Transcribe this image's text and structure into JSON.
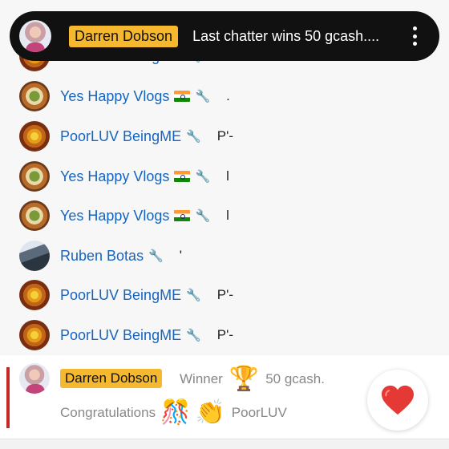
{
  "pinned": {
    "name": "Darren Dobson",
    "text": "Last chatter wins 50 gcash....",
    "menu_icon": "more-vertical-icon"
  },
  "messages": [
    {
      "name": "PoorLUV BeingME",
      "text": "",
      "avatar": "poorluv-avatar"
    },
    {
      "name": "Yes Happy Vlogs",
      "text": ".",
      "avatar": "food-avatar",
      "flag": true
    },
    {
      "name": "PoorLUV BeingME",
      "text": "P'-",
      "avatar": "poorluv-avatar"
    },
    {
      "name": "Yes Happy Vlogs",
      "text": "l",
      "avatar": "food-avatar",
      "flag": true
    },
    {
      "name": "Yes Happy Vlogs",
      "text": "l",
      "avatar": "food-avatar",
      "flag": true
    },
    {
      "name": "Ruben Botas",
      "text": "'",
      "avatar": "ruben-avatar"
    },
    {
      "name": "PoorLUV BeingME",
      "text": "P'-",
      "avatar": "poorluv-avatar"
    },
    {
      "name": "PoorLUV BeingME",
      "text": "P'-",
      "avatar": "poorluv-avatar"
    }
  ],
  "winner": {
    "name": "Darren Dobson",
    "label": "Winner",
    "prize": "50 gcash.",
    "congrats": "Congratulations",
    "tail": "PoorLUV",
    "icons": [
      "trophy-icon",
      "party-popper-icon",
      "clapping-hands-icon"
    ],
    "heart_icon": "heart-icon",
    "accent_color": "#c62828"
  },
  "colors": {
    "name_link": "#1565c0",
    "badge_bg": "#f5b82e",
    "pinned_bg": "#111111"
  }
}
